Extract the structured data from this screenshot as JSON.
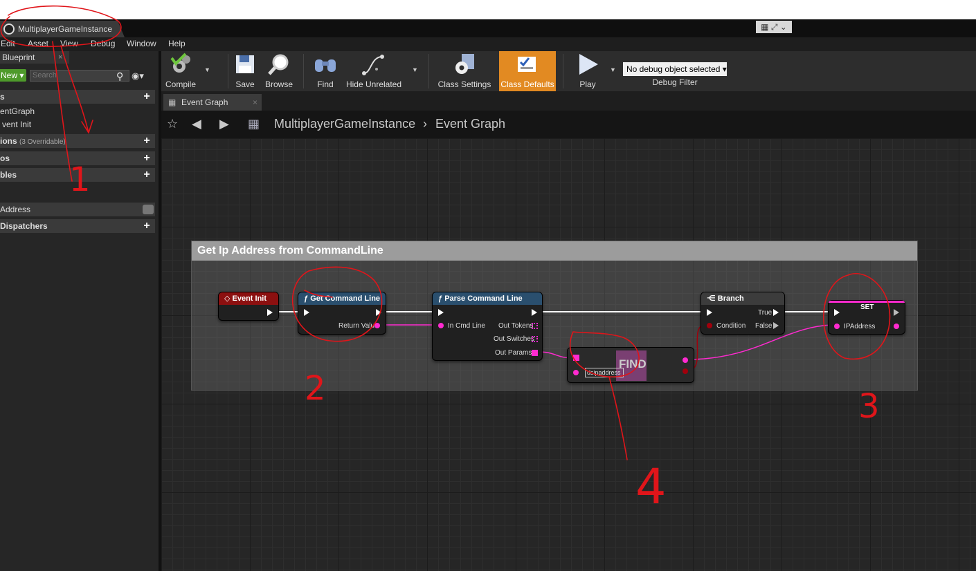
{
  "window": {
    "title": "MultiplayerGameInstance"
  },
  "menu": [
    "Edit",
    "Asset",
    "View",
    "Debug",
    "Window",
    "Help"
  ],
  "left_panel": {
    "tab": "Blueprint",
    "new_label": "New",
    "search_placeholder": "Search",
    "sections": {
      "graphs": "s",
      "functions": "ions",
      "functions_sub": "(3 Overridable)",
      "macros": "os",
      "variables": "bles",
      "dispatchers": "Dispatchers"
    },
    "graph_items": [
      "entGraph",
      "vent Init"
    ],
    "variable_item": "Address"
  },
  "toolbar": {
    "compile": "Compile",
    "save": "Save",
    "browse": "Browse",
    "find": "Find",
    "hide_unrelated": "Hide Unrelated",
    "class_settings": "Class Settings",
    "class_defaults": "Class Defaults",
    "play": "Play",
    "debug_select": "No debug object selected",
    "debug_filter": "Debug Filter"
  },
  "graph_tab": "Event Graph",
  "breadcrumb": {
    "blueprint": "MultiplayerGameInstance",
    "sep": "›",
    "graph": "Event Graph"
  },
  "comment": "Get Ip Address from CommandLine",
  "nodes": {
    "event_init": {
      "title": "Event Init"
    },
    "get_command_line": {
      "title": "Get Command Line",
      "out": "Return Value"
    },
    "parse_command_line": {
      "title": "Parse Command Line",
      "in": "In Cmd Line",
      "out1": "Out Tokens",
      "out2": "Out Switches",
      "out3": "Out Params"
    },
    "find": {
      "title": "FIND",
      "key": "dsipaddress"
    },
    "branch": {
      "title": "Branch",
      "cond": "Condition",
      "true": "True",
      "false": "False"
    },
    "set": {
      "title": "SET",
      "var": "IPAddress"
    }
  },
  "annotations": [
    "1",
    "2",
    "3",
    "4"
  ],
  "colors": {
    "accent": "#e28a22",
    "string_pin": "#ff2ad0",
    "bool_pin": "#a1000c",
    "annotation": "#e0151a"
  }
}
